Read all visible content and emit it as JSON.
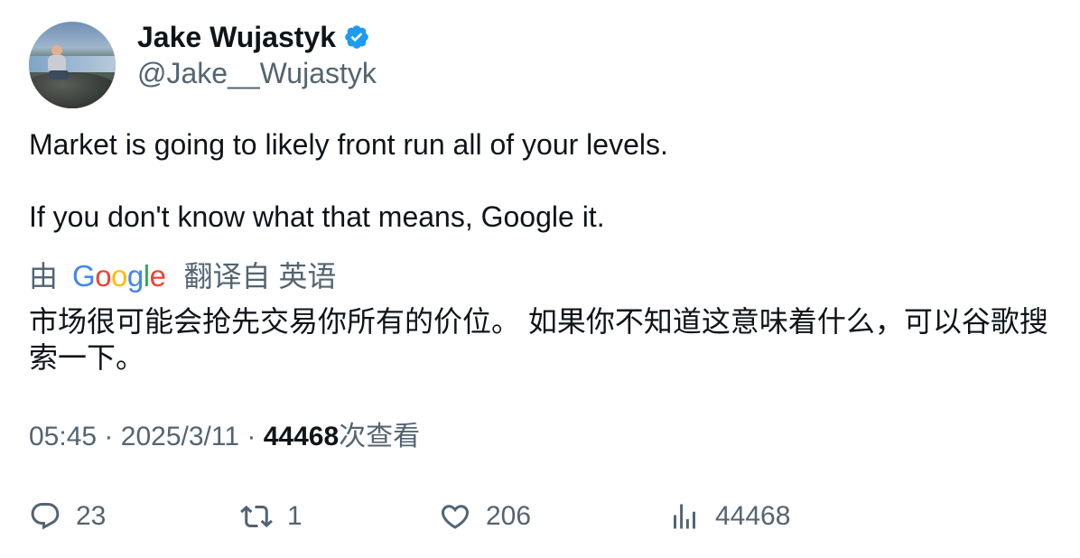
{
  "author": {
    "display_name": "Jake Wujastyk",
    "handle": "@Jake__Wujastyk",
    "verified_icon": "verified-badge-icon",
    "verified_color": "#1d9bf0"
  },
  "tweet": {
    "paragraph_1": "Market is going to likely front run all of your levels.",
    "paragraph_2": "If you don't know what that means, Google it."
  },
  "translation": {
    "prefix": "由",
    "provider": "Google",
    "suffix": "翻译自 英语",
    "text": "市场很可能会抢先交易你所有的价位。 如果你不知道这意味着什么，可以谷歌搜索一下。"
  },
  "meta": {
    "time": "05:45",
    "separator_1": "·",
    "date": "2025/3/11",
    "separator_2": "·",
    "views_count": "44468",
    "views_label": "次查看"
  },
  "actions": {
    "replies": "23",
    "retweets": "1",
    "likes": "206",
    "views": "44468"
  },
  "colors": {
    "text_primary": "#0f1419",
    "text_secondary": "#536471",
    "google_blue": "#4285f4",
    "google_red": "#ea4335",
    "google_yellow": "#fbbc05",
    "google_green": "#34a853"
  }
}
